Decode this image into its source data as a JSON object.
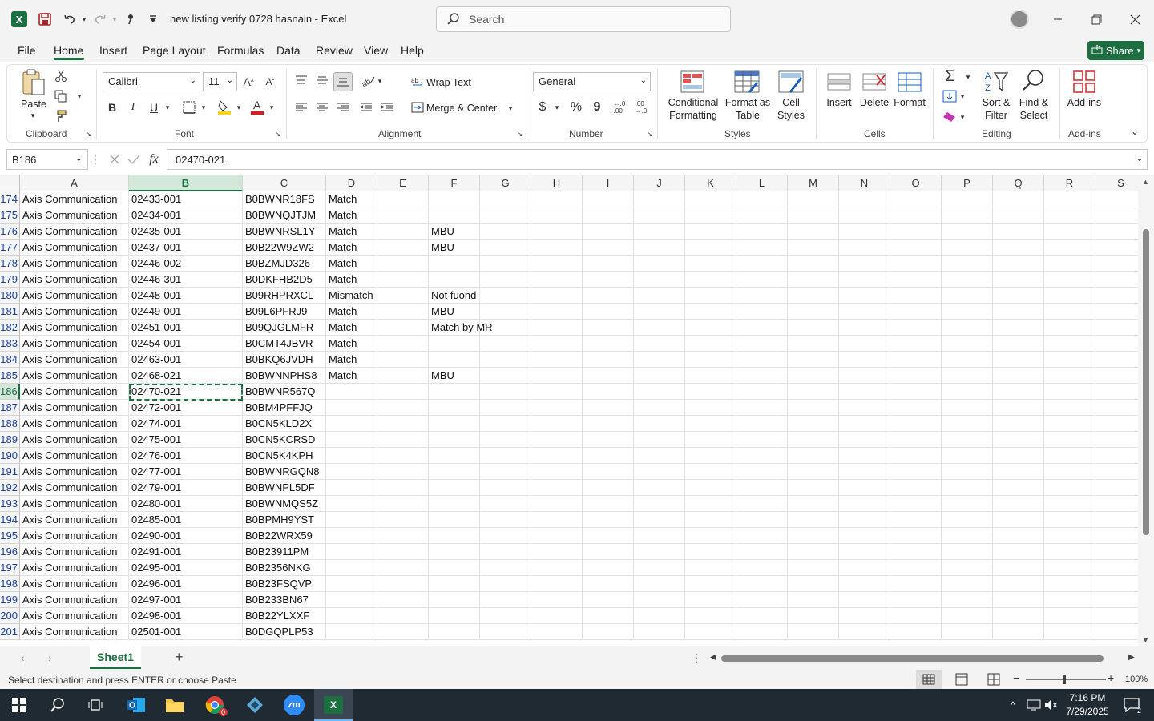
{
  "window": {
    "title": "new listing verify 0728 hasnain  -  Excel",
    "search_placeholder": "Search"
  },
  "menu": {
    "items": [
      "File",
      "Home",
      "Insert",
      "Page Layout",
      "Formulas",
      "Data",
      "Review",
      "View",
      "Help"
    ],
    "share": "Share"
  },
  "ribbon": {
    "clipboard": {
      "label": "Clipboard",
      "paste": "Paste"
    },
    "font": {
      "label": "Font",
      "family": "Calibri",
      "size": "11"
    },
    "alignment": {
      "label": "Alignment",
      "wrap": "Wrap Text",
      "merge": "Merge & Center"
    },
    "number": {
      "label": "Number",
      "format": "General"
    },
    "styles": {
      "label": "Styles",
      "conditional": "Conditional Formatting",
      "format_table": "Format as Table",
      "cell_styles": "Cell Styles"
    },
    "cells": {
      "label": "Cells",
      "insert": "Insert",
      "delete": "Delete",
      "format": "Format"
    },
    "editing": {
      "label": "Editing",
      "sort": "Sort & Filter",
      "find": "Find & Select"
    },
    "addins": {
      "label": "Add-ins",
      "addins": "Add-ins"
    }
  },
  "formula_bar": {
    "name_box": "B186",
    "formula": "02470-021"
  },
  "grid": {
    "columns": [
      "A",
      "B",
      "C",
      "D",
      "E",
      "F",
      "G",
      "H",
      "I",
      "J",
      "K",
      "L",
      "M",
      "N",
      "O",
      "P",
      "Q",
      "R",
      "S"
    ],
    "selected_column": "B",
    "selected_row": "186",
    "rows": [
      {
        "n": "174",
        "a": "Axis Communication",
        "b": "02433-001",
        "c": "B0BWNR18FS",
        "d": "Match",
        "f": ""
      },
      {
        "n": "175",
        "a": "Axis Communication",
        "b": "02434-001",
        "c": "B0BWNQJTJM",
        "d": "Match",
        "f": ""
      },
      {
        "n": "176",
        "a": "Axis Communication",
        "b": "02435-001",
        "c": "B0BWNRSL1Y",
        "d": "Match",
        "f": "MBU"
      },
      {
        "n": "177",
        "a": "Axis Communication",
        "b": "02437-001",
        "c": "B0B22W9ZW2",
        "d": "Match",
        "f": "MBU"
      },
      {
        "n": "178",
        "a": "Axis Communication",
        "b": "02446-002",
        "c": "B0BZMJD326",
        "d": "Match",
        "f": ""
      },
      {
        "n": "179",
        "a": "Axis Communication",
        "b": "02446-301",
        "c": "B0DKFHB2D5",
        "d": "Match",
        "f": ""
      },
      {
        "n": "180",
        "a": "Axis Communication",
        "b": "02448-001",
        "c": "B09RHPRXCL",
        "d": "Mismatch",
        "f": "Not fuond"
      },
      {
        "n": "181",
        "a": "Axis Communication",
        "b": "02449-001",
        "c": "B09L6PFRJ9",
        "d": "Match",
        "f": "MBU"
      },
      {
        "n": "182",
        "a": "Axis Communication",
        "b": "02451-001",
        "c": "B09QJGLMFR",
        "d": "Match",
        "f": "Match by MR"
      },
      {
        "n": "183",
        "a": "Axis Communication",
        "b": "02454-001",
        "c": "B0CMT4JBVR",
        "d": "Match",
        "f": ""
      },
      {
        "n": "184",
        "a": "Axis Communication",
        "b": "02463-001",
        "c": "B0BKQ6JVDH",
        "d": "Match",
        "f": ""
      },
      {
        "n": "185",
        "a": "Axis Communication",
        "b": "02468-021",
        "c": "B0BWNNPHS8",
        "d": "Match",
        "f": "MBU"
      },
      {
        "n": "186",
        "a": "Axis Communication",
        "b": "02470-021",
        "c": "B0BWNR567Q",
        "d": "",
        "f": ""
      },
      {
        "n": "187",
        "a": "Axis Communication",
        "b": "02472-001",
        "c": "B0BM4PFFJQ",
        "d": "",
        "f": ""
      },
      {
        "n": "188",
        "a": "Axis Communication",
        "b": "02474-001",
        "c": "B0CN5KLD2X",
        "d": "",
        "f": ""
      },
      {
        "n": "189",
        "a": "Axis Communication",
        "b": "02475-001",
        "c": "B0CN5KCRSD",
        "d": "",
        "f": ""
      },
      {
        "n": "190",
        "a": "Axis Communication",
        "b": "02476-001",
        "c": "B0CN5K4KPH",
        "d": "",
        "f": ""
      },
      {
        "n": "191",
        "a": "Axis Communication",
        "b": "02477-001",
        "c": "B0BWNRGQN8",
        "d": "",
        "f": ""
      },
      {
        "n": "192",
        "a": "Axis Communication",
        "b": "02479-001",
        "c": "B0BWNPL5DF",
        "d": "",
        "f": ""
      },
      {
        "n": "193",
        "a": "Axis Communication",
        "b": "02480-001",
        "c": "B0BWNMQS5Z",
        "d": "",
        "f": ""
      },
      {
        "n": "194",
        "a": "Axis Communication",
        "b": "02485-001",
        "c": "B0BPMH9YST",
        "d": "",
        "f": ""
      },
      {
        "n": "195",
        "a": "Axis Communication",
        "b": "02490-001",
        "c": "B0B22WRX59",
        "d": "",
        "f": ""
      },
      {
        "n": "196",
        "a": "Axis Communication",
        "b": "02491-001",
        "c": "B0B23911PM",
        "d": "",
        "f": ""
      },
      {
        "n": "197",
        "a": "Axis Communication",
        "b": "02495-001",
        "c": "B0B2356NKG",
        "d": "",
        "f": ""
      },
      {
        "n": "198",
        "a": "Axis Communication",
        "b": "02496-001",
        "c": "B0B23FSQVP",
        "d": "",
        "f": ""
      },
      {
        "n": "199",
        "a": "Axis Communication",
        "b": "02497-001",
        "c": "B0B233BN67",
        "d": "",
        "f": ""
      },
      {
        "n": "200",
        "a": "Axis Communication",
        "b": "02498-001",
        "c": "B0B22YLXXF",
        "d": "",
        "f": ""
      },
      {
        "n": "201",
        "a": "Axis Communication",
        "b": "02501-001",
        "c": "B0DGQPLP53",
        "d": "",
        "f": ""
      }
    ]
  },
  "sheets": {
    "active": "Sheet1"
  },
  "status": {
    "message": "Select destination and press ENTER or choose Paste",
    "zoom": "100%"
  },
  "taskbar": {
    "time": "7:16 PM",
    "date": "7/29/2025",
    "notification_count": "2",
    "chrome_badge": "0"
  },
  "colors": {
    "excel_green": "#1d6f42",
    "taskbar": "#202a33",
    "row_number": "#1a3f9a"
  }
}
